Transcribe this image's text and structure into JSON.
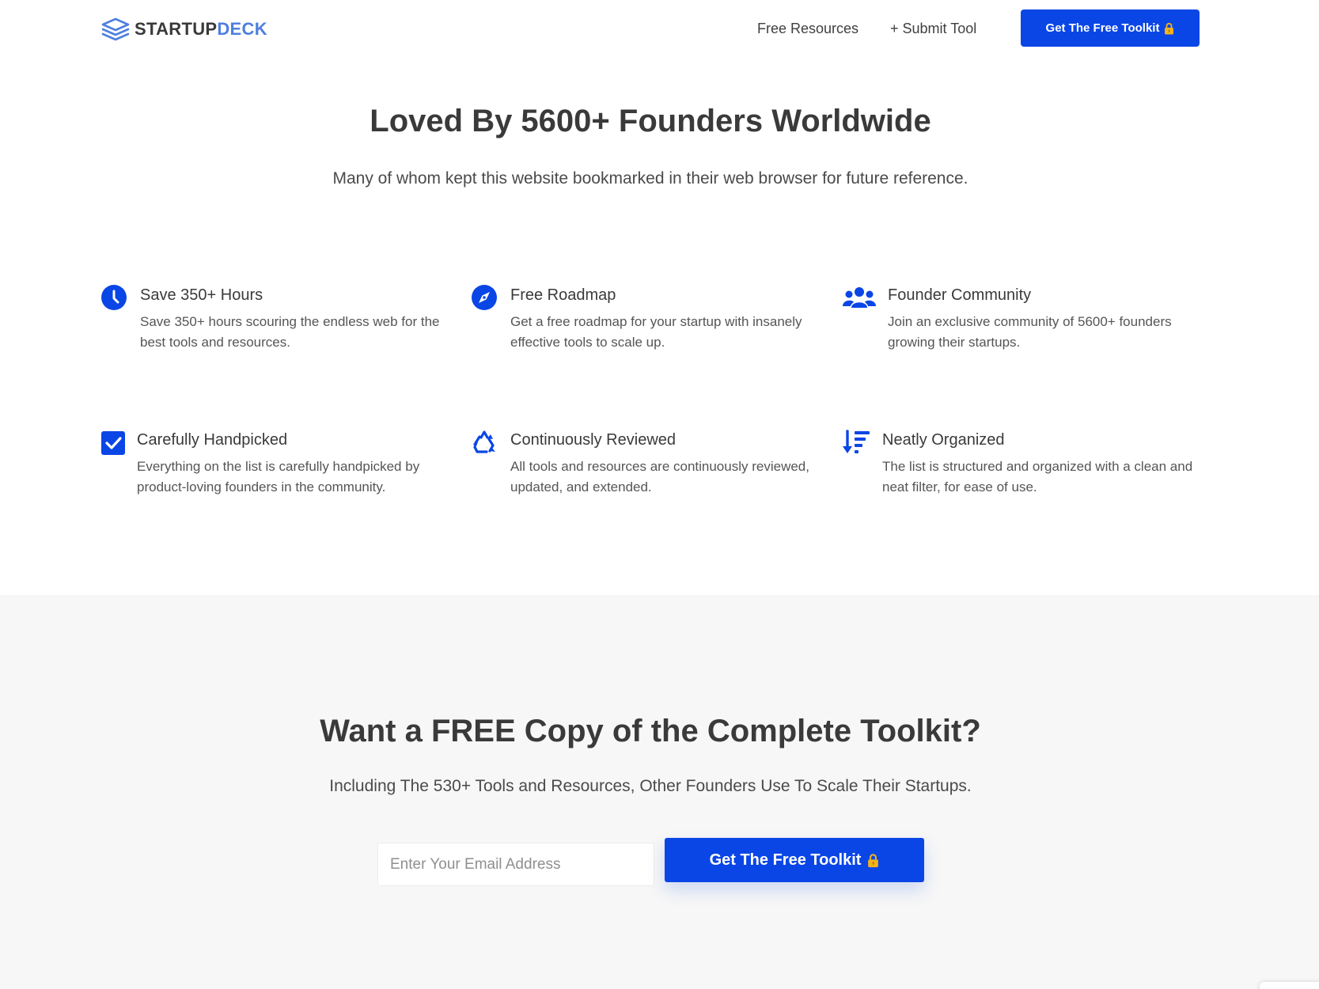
{
  "brand": {
    "logo_part1": "STARTUP",
    "logo_part2": "DECK",
    "accent_color": "#0a46e6",
    "logo_color": "#4e7fe0"
  },
  "nav": {
    "free_resources": "Free Resources",
    "submit_tool": "+ Submit Tool",
    "cta_label": "Get The Free Toolkit",
    "cta_icon": "lock-icon"
  },
  "hero": {
    "title": "Loved By 5600+ Founders Worldwide",
    "subtitle": "Many of whom kept this website bookmarked in their web browser for future reference."
  },
  "features": [
    {
      "icon": "clock-icon",
      "title": "Save 350+ Hours",
      "description": "Save 350+ hours scouring the endless web for the best tools and resources."
    },
    {
      "icon": "compass-icon",
      "title": "Free Roadmap",
      "description": "Get a free roadmap for your startup with insanely effective tools to scale up."
    },
    {
      "icon": "users-icon",
      "title": "Founder Community",
      "description": "Join an exclusive community of 5600+ founders growing their startups."
    },
    {
      "icon": "check-square-icon",
      "title": "Carefully Handpicked",
      "description": "Everything on the list is carefully handpicked by product-loving founders in the community."
    },
    {
      "icon": "recycle-icon",
      "title": "Continuously Reviewed",
      "description": "All tools and resources are continuously reviewed, updated, and extended."
    },
    {
      "icon": "sort-amount-down-icon",
      "title": "Neatly Organized",
      "description": "The list is structured and organized with a clean and neat filter, for ease of use."
    }
  ],
  "signup": {
    "title": "Want a FREE Copy of the Complete Toolkit?",
    "subtitle": "Including The 530+ Tools and Resources, Other Founders Use To Scale Their Startups.",
    "email_placeholder": "Enter Your Email Address",
    "email_value": "",
    "button_label": "Get The Free Toolkit",
    "button_icon": "lock-icon"
  }
}
